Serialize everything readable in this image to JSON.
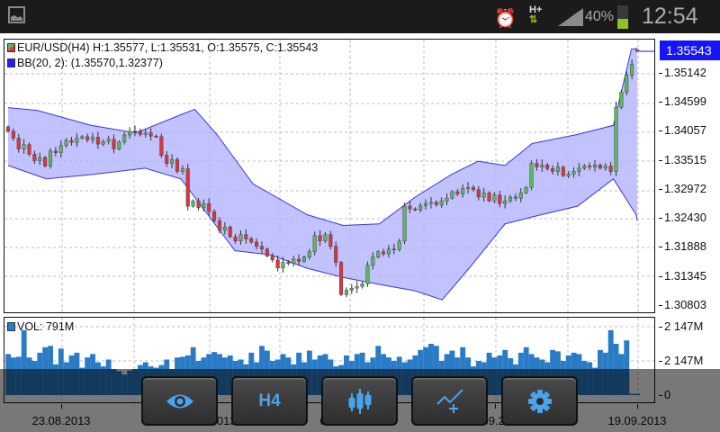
{
  "status_bar": {
    "battery_percent": "40%",
    "time": "12:54",
    "network": "H+"
  },
  "chart_legend": {
    "symbol_line": "EUR/USD(H4) H:1.35577, L:1.35531, O:1.35575, C:1.35543",
    "bb_line": "BB(20, 2): (1.35570,1.32377)",
    "volume_line": "VOL: 791M"
  },
  "current_price": "1.35543",
  "price_axis": [
    "1.35142",
    "1.34599",
    "1.34057",
    "1.33515",
    "1.32972",
    "1.32430",
    "1.31888",
    "1.31345",
    "1.30803"
  ],
  "volume_axis": [
    "2 147M",
    "2 147M",
    "0"
  ],
  "date_axis": [
    "23.08.2013",
    "30.08.2013",
    "06.09.2013",
    "12.09.2013",
    "19.09.2013"
  ],
  "toolbar": [
    {
      "name": "view",
      "icon": "eye-icon"
    },
    {
      "name": "timeframe",
      "label": "H4"
    },
    {
      "name": "chart-type",
      "icon": "candlestick-icon"
    },
    {
      "name": "add-indicator",
      "icon": "indicator-add-icon"
    },
    {
      "name": "settings",
      "icon": "gear-icon"
    }
  ],
  "colors": {
    "up": "#5cb85c",
    "down": "#d9363e",
    "band_fill": "#b3b3ff",
    "band_line": "#3535e6",
    "volume": "#2a7bc6",
    "price_box": "#1414ff",
    "toolbar_icon": "#4aa3ee"
  },
  "chart_data": {
    "type": "candlestick",
    "symbol": "EUR/USD",
    "timeframe": "H4",
    "ylim": [
      1.3065,
      1.358
    ],
    "last_candle": {
      "open": 1.35575,
      "high": 1.35577,
      "low": 1.35531,
      "close": 1.35543
    },
    "closes": [
      1.3405,
      1.3392,
      1.3372,
      1.338,
      1.3362,
      1.335,
      1.3356,
      1.334,
      1.3368,
      1.3365,
      1.3378,
      1.3388,
      1.3384,
      1.3392,
      1.3395,
      1.3389,
      1.3394,
      1.3381,
      1.3386,
      1.339,
      1.3372,
      1.3385,
      1.3398,
      1.3405,
      1.3406,
      1.3399,
      1.3402,
      1.3396,
      1.3395,
      1.336,
      1.3345,
      1.3352,
      1.333,
      1.3335,
      1.3265,
      1.3275,
      1.3262,
      1.327,
      1.3255,
      1.3238,
      1.322,
      1.3226,
      1.3208,
      1.32,
      1.3212,
      1.3204,
      1.3198,
      1.319,
      1.3185,
      1.3172,
      1.3165,
      1.315,
      1.316,
      1.3158,
      1.3166,
      1.3162,
      1.317,
      1.318,
      1.321,
      1.32,
      1.3212,
      1.319,
      1.316,
      1.31,
      1.3108,
      1.3112,
      1.3115,
      1.312,
      1.3155,
      1.317,
      1.318,
      1.3176,
      1.3185,
      1.3184,
      1.32,
      1.3265,
      1.326,
      1.3258,
      1.3266,
      1.327,
      1.3272,
      1.3268,
      1.3275,
      1.328,
      1.3292,
      1.3288,
      1.3298,
      1.33,
      1.3296,
      1.3282,
      1.329,
      1.3275,
      1.3286,
      1.327,
      1.3275,
      1.3282,
      1.328,
      1.329,
      1.33,
      1.3345,
      1.3338,
      1.3342,
      1.3335,
      1.333,
      1.3338,
      1.3322,
      1.3325,
      1.333,
      1.3336,
      1.334,
      1.3338,
      1.3342,
      1.3336,
      1.334,
      1.333,
      1.345,
      1.3478,
      1.351,
      1.353,
      1.35543
    ],
    "bb_upper": [
      [
        0,
        1.3449
      ],
      [
        5.5,
        1.3444
      ],
      [
        15.7,
        1.3416
      ],
      [
        24.2,
        1.3402
      ],
      [
        32.7,
        1.3436
      ],
      [
        35.3,
        1.3446
      ],
      [
        39.5,
        1.3399
      ],
      [
        46.3,
        1.3307
      ],
      [
        56.6,
        1.3249
      ],
      [
        63.4,
        1.3229
      ],
      [
        70.2,
        1.3232
      ],
      [
        77,
        1.3282
      ],
      [
        83.8,
        1.3324
      ],
      [
        88.9,
        1.3349
      ],
      [
        94,
        1.3341
      ],
      [
        99.1,
        1.3382
      ],
      [
        107.7,
        1.3399
      ],
      [
        114.5,
        1.3416
      ],
      [
        117.9,
        1.3558
      ],
      [
        119,
        1.356
      ]
    ],
    "bb_lower": [
      [
        0,
        1.3341
      ],
      [
        7.2,
        1.3316
      ],
      [
        15.7,
        1.3324
      ],
      [
        25.9,
        1.3336
      ],
      [
        32.7,
        1.3316
      ],
      [
        37.8,
        1.3249
      ],
      [
        42.9,
        1.3182
      ],
      [
        49.7,
        1.3174
      ],
      [
        56.6,
        1.3149
      ],
      [
        63.4,
        1.3132
      ],
      [
        70.2,
        1.3119
      ],
      [
        77,
        1.3107
      ],
      [
        82.1,
        1.309
      ],
      [
        87.2,
        1.3149
      ],
      [
        94,
        1.3232
      ],
      [
        100.8,
        1.3249
      ],
      [
        107.7,
        1.3265
      ],
      [
        114.5,
        1.3316
      ],
      [
        118.8,
        1.3249
      ],
      [
        119,
        1.3238
      ]
    ],
    "volume_relative": [
      60,
      55,
      56,
      95,
      55,
      50,
      62,
      70,
      72,
      45,
      68,
      48,
      58,
      62,
      40,
      55,
      60,
      48,
      42,
      52,
      38,
      35,
      30,
      36,
      38,
      44,
      48,
      42,
      40,
      44,
      52,
      38,
      55,
      56,
      58,
      70,
      50,
      55,
      60,
      63,
      60,
      55,
      58,
      50,
      52,
      45,
      62,
      48,
      72,
      65,
      50,
      52,
      60,
      55,
      45,
      62,
      48,
      65,
      52,
      58,
      60,
      52,
      42,
      44,
      58,
      50,
      60,
      62,
      48,
      55,
      72,
      60,
      55,
      50,
      56,
      48,
      52,
      58,
      66,
      70,
      75,
      72,
      50,
      60,
      65,
      55,
      70,
      55,
      42,
      50,
      48,
      62,
      55,
      58,
      66,
      54,
      45,
      62,
      70,
      60,
      55,
      52,
      48,
      66,
      64,
      50,
      58,
      62,
      60,
      50,
      48,
      40,
      66,
      62,
      95,
      75,
      60,
      80,
      2,
      2
    ]
  }
}
